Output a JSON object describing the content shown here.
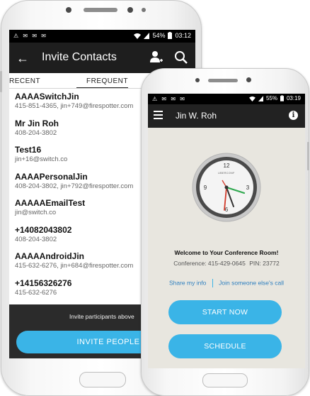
{
  "back_phone": {
    "status": {
      "icons_left": "⚠ ✉ ✉ ✉",
      "battery": "54%",
      "time": "03:12"
    },
    "app_bar": {
      "back_icon": "arrow-left-icon",
      "title": "Invite Contacts",
      "add_icon": "add-person-icon",
      "search_icon": "search-icon"
    },
    "tabs": [
      {
        "label": "RECENT"
      },
      {
        "label": "FREQUENT"
      }
    ],
    "contacts": [
      {
        "name": "AAAASwitchJin",
        "detail": "415-851-4365, jin+749@firespotter.com"
      },
      {
        "name": "Mr Jin Roh",
        "detail": "408-204-3802"
      },
      {
        "name": "Test16",
        "detail": "jin+16@switch.co"
      },
      {
        "name": "AAAAPersonalJin",
        "detail": "408-204-3802, jin+792@firespotter.com"
      },
      {
        "name": "AAAAAEmailTest",
        "detail": "jin@switch.co"
      },
      {
        "name": "+14082043802",
        "detail": "408-204-3802"
      },
      {
        "name": "AAAAAndroidJin",
        "detail": "415-632-6276, jin+684@firespotter.com"
      },
      {
        "name": "+14156326276",
        "detail": "415-632-6276"
      }
    ],
    "footer": {
      "hint": "Invite participants above",
      "button": "INVITE PEOPLE"
    }
  },
  "front_phone": {
    "status": {
      "battery": "55%",
      "time": "03:19"
    },
    "app_bar": {
      "menu_icon": "menu-icon",
      "title": "Jin W. Roh",
      "info_icon": "info-icon"
    },
    "clock": {
      "brand": "UBERCONF",
      "numerals": [
        "12",
        "3",
        "6",
        "9"
      ],
      "hand_colors": {
        "hour": "#d23a2a",
        "minute": "#333333",
        "second": "#2fa84f"
      }
    },
    "welcome": "Welcome to Your Conference Room!",
    "conference": {
      "number": "Conference: 415-429-0645",
      "pin": "PIN: 23772"
    },
    "links": {
      "share": "Share my info",
      "join": "Join someone else's call"
    },
    "buttons": {
      "start": "START NOW",
      "schedule": "SCHEDULE"
    },
    "accent_color": "#3ab4e7"
  }
}
